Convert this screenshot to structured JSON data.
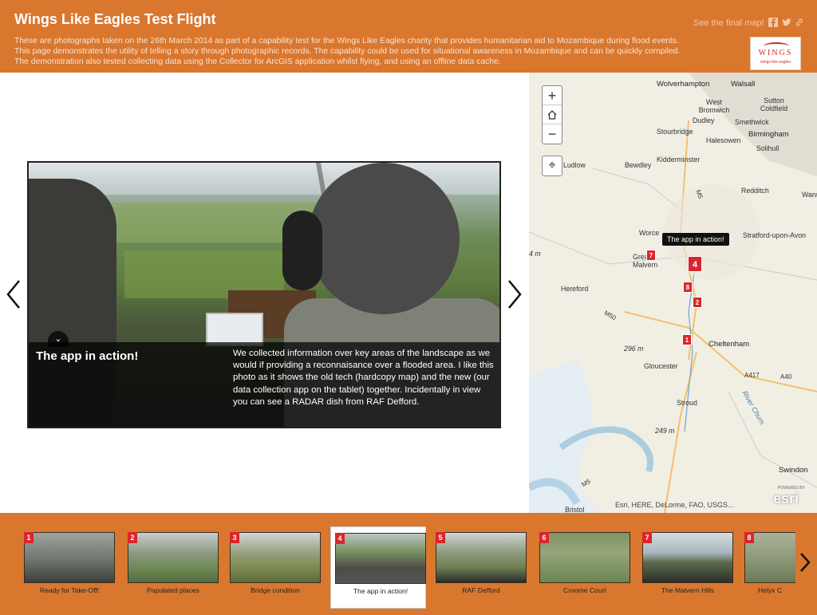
{
  "header": {
    "title": "Wings Like Eagles Test Flight",
    "description": "These are photographs taken on the 26th March 2014 as part of a capability test for the Wings Like Eagles charity that provides humanitarian aid to Mozambique during flood events. This page demonstrates the utility of telling a story through photographic records. The capability could be used for situational awareness in Mozambique and can be quickly compiled. The demonstration also tested collecting data using the Collector for ArcGIS application whilst flying, and using an offline data cache.",
    "final_map_link": "See the final map!",
    "logo_text": "WINGS",
    "logo_subtext": "wings like eagles"
  },
  "slide": {
    "title": "The app in action!",
    "caption": "We collected information over key areas of the landscape as we would if providing a reconnaisance over a flooded area. I like this photo as it shows the old tech (hardcopy map) and the new (our data collection app on the tablet) together. Incidentally in view you can see a RADAR dish from RAF Defford."
  },
  "map": {
    "popup": "The app in action!",
    "attribution": "Esri, HERE, DeLorme, FAO, USGS...",
    "esri_logo": "esri",
    "powered_by": "POWERED BY",
    "places": {
      "wolverhampton": "Wolverhampton",
      "walsall": "Walsall",
      "sutton_coldfield": "Sutton Coldfield",
      "west_bromwich": "West Bromwich",
      "dudley": "Dudley",
      "smethwick": "Smethwick",
      "stourbridge": "Stourbridge",
      "birmingham": "Birmingham",
      "halesowen": "Halesowen",
      "solihull": "Solihull",
      "ludlow": "Ludlow",
      "bewdley": "Bewdley",
      "kidderminster": "Kidderminster",
      "redditch": "Redditch",
      "warwick": "Warw",
      "worcester": "Worce",
      "stratford": "Stratford-upon-Avon",
      "great_malvern": "Great Malvern",
      "hereford": "Hereford",
      "cheltenham": "Cheltenham",
      "gloucester": "Gloucester",
      "stroud": "Stroud",
      "swindon": "Swindon",
      "bristol": "Bristol",
      "river_churn": "River Churn",
      "elev_296": "296 m",
      "elev_249": "249 m",
      "elev_4": "4 m",
      "road_m5": "M5",
      "road_m50": "M50",
      "road_a40": "A40",
      "road_m5b": "M5",
      "road_a417": "A417"
    },
    "markers": [
      "7",
      "4",
      "8",
      "2",
      "1"
    ]
  },
  "carousel": {
    "items": [
      {
        "num": "1",
        "label": "Ready for Take-Off!"
      },
      {
        "num": "2",
        "label": "Populated places"
      },
      {
        "num": "3",
        "label": "Bridge condition"
      },
      {
        "num": "4",
        "label": "The app in action!"
      },
      {
        "num": "5",
        "label": "RAF Defford"
      },
      {
        "num": "6",
        "label": "Croome Court"
      },
      {
        "num": "7",
        "label": "The Malvern Hills"
      },
      {
        "num": "8",
        "label": "Helyx C"
      }
    ],
    "active_index": 3
  },
  "colors": {
    "header_bg": "#d9772f",
    "marker_red": "#d9262c"
  }
}
